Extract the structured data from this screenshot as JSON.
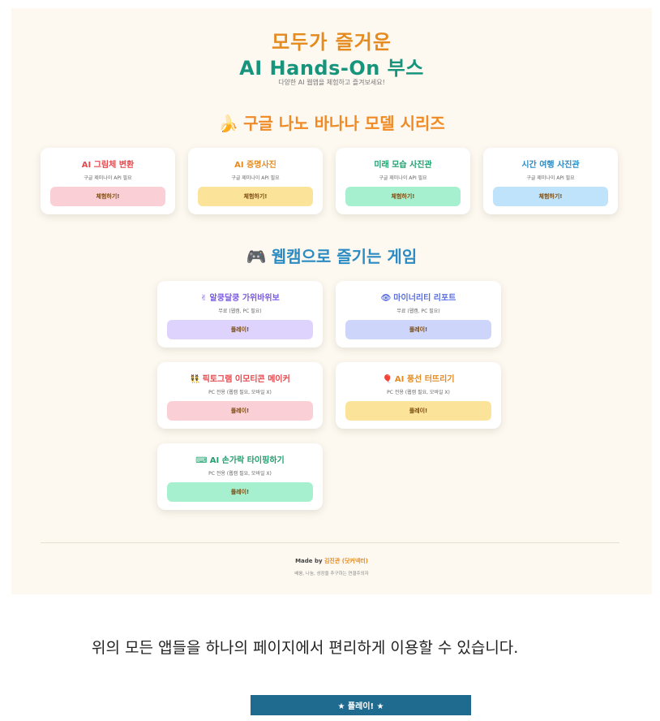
{
  "hero": {
    "title_line1": "모두가 즐거운",
    "title_line2": "AI Hands-On 부스",
    "subtitle": "다양한 AI 웹앱을 체험하고 즐겨보세요!"
  },
  "section_nano": {
    "emoji": "🍌",
    "title": "구글 나노 바나나 모델 시리즈",
    "cards": [
      {
        "title": "AI 그림체 변환",
        "desc": "구글 제미나이 API 필요",
        "button": "체험하기!",
        "title_color": "#e5484d",
        "button_color": "#fbcfd6"
      },
      {
        "title": "AI 증명사진",
        "desc": "구글 제미나이 API 필요",
        "button": "체험하기!",
        "title_color": "#e58a1f",
        "button_color": "#fbe49a"
      },
      {
        "title": "미래 모습 사진관",
        "desc": "구글 제미나이 API 필요",
        "button": "체험하기!",
        "title_color": "#21a06f",
        "button_color": "#a7f0cf"
      },
      {
        "title": "시간 여행 사진관",
        "desc": "구글 제미나이 API 필요",
        "button": "체험하기!",
        "title_color": "#2b8bc2",
        "button_color": "#bfe3fa"
      }
    ]
  },
  "section_games": {
    "emoji": "🎮",
    "title": "웹캠으로 즐기는 게임",
    "cards": [
      {
        "icon": "✌",
        "title": "알쿵달쿵 가위바위보",
        "desc": "무료 (웹캠, PC 필요)",
        "button": "플레이!",
        "title_color": "#7b5be0",
        "button_color": "#ddd3fd"
      },
      {
        "icon": "👁",
        "title": "마이너리티 리포트",
        "desc": "무료 (웹캠, PC 필요)",
        "button": "플레이!",
        "title_color": "#5b6fe0",
        "button_color": "#cdd5fb"
      },
      {
        "icon": "👯",
        "title": "픽토그램 이모티콘 메이커",
        "desc": "PC 전용 (웹캠 필요, 모바일 X)",
        "button": "플레이!",
        "title_color": "#e5484d",
        "button_color": "#fbcfd6"
      },
      {
        "icon": "🎈",
        "title": "AI 풍선 터뜨리기",
        "desc": "PC 전용 (웹캠 필요, 모바일 X)",
        "button": "플레이!",
        "title_color": "#e58a1f",
        "button_color": "#fbe49a"
      },
      {
        "icon": "⌨",
        "title": "AI 손가락 타이핑하기",
        "desc": "PC 전용 (웹캠 필요, 모바일 X)",
        "button": "플레이!",
        "title_color": "#21a06f",
        "button_color": "#a7f0cf"
      }
    ]
  },
  "footer": {
    "made_by_prefix": "Made by ",
    "author": "김진관 (닷커넥터)",
    "motto": "배움, 나눔, 성장을 추구하는 연결주의자"
  },
  "notice": "위의 모든 앱들을 하나의 페이지에서 편리하게 이용할 수 있습니다.",
  "play_button": "★ 플레이! ★"
}
